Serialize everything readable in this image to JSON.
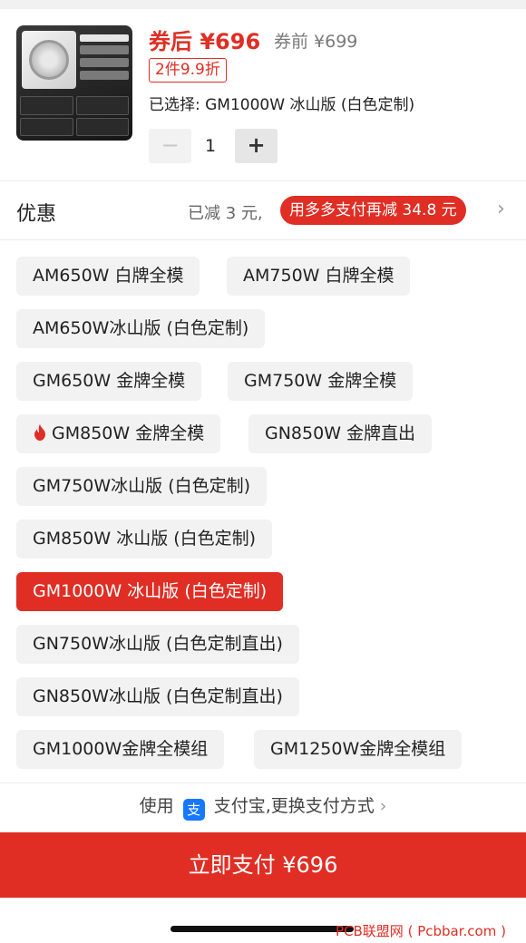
{
  "product": {
    "image_alt": "GM1000W 冰山版",
    "price_after": "券后 ¥696",
    "price_before": "券前 ¥699",
    "discount_tag": "2件9.9折",
    "selected": "已选择: GM1000W 冰山版 (白色定制)",
    "quantity": "1",
    "minus_label": "−",
    "plus_label": "+"
  },
  "promo": {
    "title": "优惠",
    "reduced": "已减 3 元,",
    "badge": "用多多支付再减 34.8 元",
    "chevron": "›"
  },
  "options": [
    {
      "label": "AM650W 白牌全模"
    },
    {
      "label": "AM750W 白牌全模"
    },
    {
      "label": "AM650W冰山版 (白色定制)"
    },
    {
      "label": "GM650W 金牌全模"
    },
    {
      "label": "GM750W 金牌全模"
    },
    {
      "label": "GM850W 金牌全模",
      "hot": true
    },
    {
      "label": "GN850W 金牌直出"
    },
    {
      "label": "GM750W冰山版 (白色定制)"
    },
    {
      "label": "GM850W 冰山版 (白色定制)"
    },
    {
      "label": "GM1000W 冰山版 (白色定制)",
      "selected": true
    },
    {
      "label": "GN750W冰山版 (白色定制直出)"
    },
    {
      "label": "GN850W冰山版 (白色定制直出)"
    },
    {
      "label": "GM1000W金牌全模组"
    },
    {
      "label": "GM1250W金牌全模组"
    }
  ],
  "payment": {
    "use_label": "使用",
    "alipay_icon_text": "支",
    "method_text": "支付宝,更换支付方式",
    "chevron": "›",
    "pay_button": "立即支付 ¥696"
  },
  "watermark": "PCB联盟网 ( Pcbbar.com )",
  "colors": {
    "accent": "#e02e24",
    "option_bg": "#f2f2f2",
    "alipay": "#1677ff"
  }
}
